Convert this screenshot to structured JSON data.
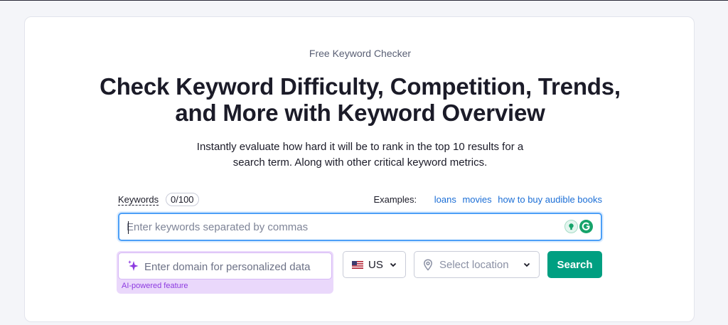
{
  "header": {
    "eyebrow": "Free Keyword Checker",
    "title_line1": "Check Keyword Difficulty, Competition, Trends,",
    "title_line2": "and More with Keyword Overview",
    "subtitle_line1": "Instantly evaluate how hard it will be to rank in the top 10 results for a",
    "subtitle_line2": "search term. Along with other critical keyword metrics."
  },
  "keywords": {
    "label": "Keywords",
    "count": "0/100",
    "examples_label": "Examples:",
    "examples": [
      "loans",
      "movies",
      "how to buy audible books"
    ],
    "placeholder": "Enter keywords separated by commas",
    "value": ""
  },
  "domain": {
    "placeholder": "Enter domain for personalized data",
    "ai_label": "AI-powered feature"
  },
  "country": {
    "value": "US"
  },
  "location": {
    "placeholder": "Select location"
  },
  "search": {
    "label": "Search"
  },
  "colors": {
    "accent": "#009f81",
    "link": "#1b6ed6",
    "ai_purple": "#8d3ae0",
    "focus_blue": "#4c9ff7"
  },
  "icons": {
    "sparkle": "sparkle-icon",
    "flag": "us-flag-icon",
    "pin": "location-pin-icon",
    "chevron": "chevron-down-icon"
  }
}
